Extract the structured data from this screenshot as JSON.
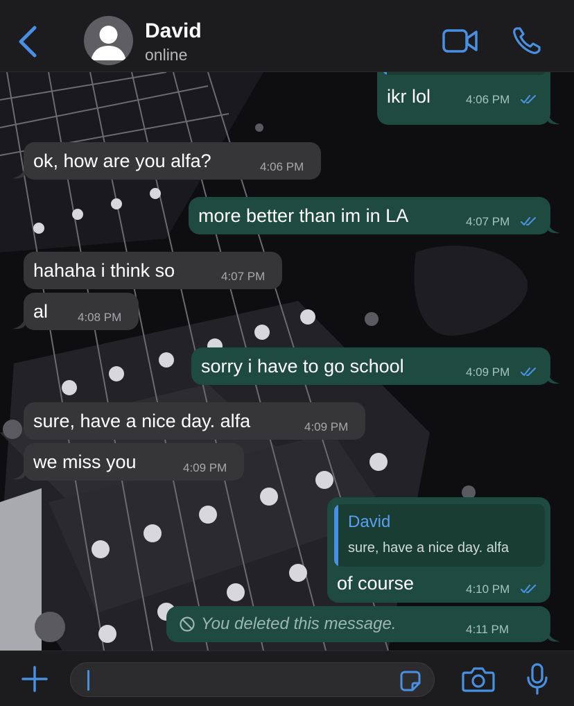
{
  "header": {
    "back_icon": "chevron-left-icon",
    "contact_name": "David",
    "contact_status": "online",
    "video_icon": "video-camera-icon",
    "call_icon": "phone-icon",
    "accent": "#4a90e2"
  },
  "messages": [
    {
      "dir": "out",
      "text": "ikr lol",
      "time": "4:06 PM",
      "status": "read",
      "partial_quote": true
    },
    {
      "dir": "in",
      "text": "ok, how are you alfa?",
      "time": "4:06 PM"
    },
    {
      "dir": "out",
      "text": "more better than im in LA",
      "time": "4:07 PM",
      "status": "read"
    },
    {
      "dir": "in",
      "text": "hahaha i think so",
      "time": "4:07 PM"
    },
    {
      "dir": "in",
      "text": "al",
      "time": "4:08 PM"
    },
    {
      "dir": "out",
      "text": "sorry i have to go school",
      "time": "4:09 PM",
      "status": "read"
    },
    {
      "dir": "in",
      "text": "sure, have a nice day. alfa",
      "time": "4:09 PM"
    },
    {
      "dir": "in",
      "text": "we miss you",
      "time": "4:09 PM"
    },
    {
      "dir": "out",
      "text": "of course",
      "time": "4:10 PM",
      "status": "read",
      "quote": {
        "name": "David",
        "text": "sure, have a nice day. alfa"
      }
    },
    {
      "dir": "out",
      "text": "You deleted this message.",
      "time": "4:11 PM",
      "deleted": true
    }
  ],
  "input": {
    "add_icon": "plus-icon",
    "placeholder": "",
    "sticker_icon": "sticker-icon",
    "camera_icon": "camera-icon",
    "mic_icon": "microphone-icon"
  },
  "colors": {
    "incoming_bubble": "#363638",
    "outgoing_bubble": "#1f4a3f",
    "read_ticks": "#4a90e2"
  }
}
